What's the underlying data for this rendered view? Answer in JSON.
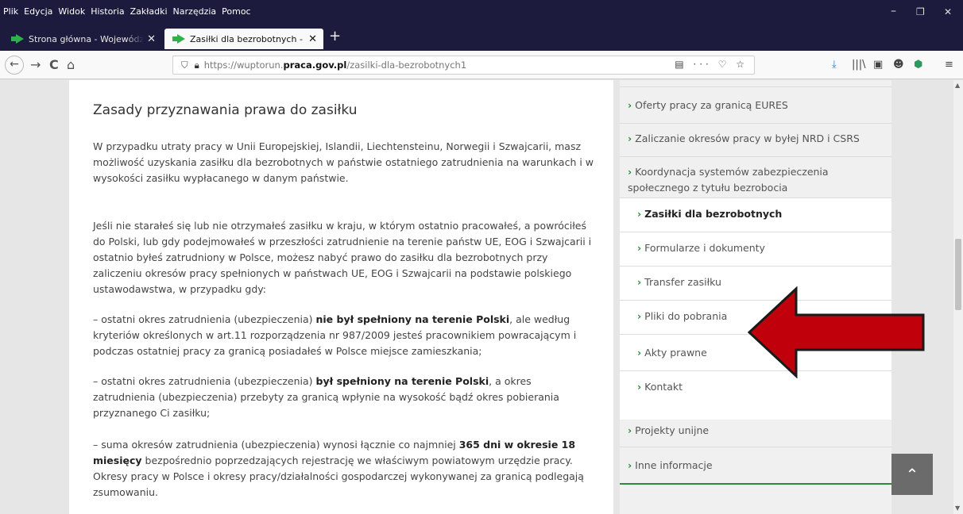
{
  "menu": [
    "Plik",
    "Edycja",
    "Widok",
    "Historia",
    "Zakładki",
    "Narzędzia",
    "Pomoc"
  ],
  "window_controls": {
    "minimize": "–",
    "restore": "❐",
    "close": "✕"
  },
  "tabs": [
    {
      "title": "Strona główna - Wojewódzki Urząd Pracy",
      "close": "✕"
    },
    {
      "title": "Zasiłki dla bezrobotnych - Wojewódzki",
      "close": "✕"
    }
  ],
  "new_tab": "+",
  "nav": {
    "back": "←",
    "forward": "→",
    "reload": "C",
    "home": "⌂"
  },
  "url": {
    "prefix": "https://wuptorun.",
    "domain": "praca.gov.pl",
    "path": "/zasilki-dla-bezrobotnych1"
  },
  "url_tools": "▤ ··· ♡ ☆",
  "right_tools": [
    "⤓",
    "|||\\",
    "▣",
    "☻",
    "⬢",
    "≡"
  ],
  "article": {
    "title": "Zasady przyznawania prawa do zasiłku",
    "p1": "W przypadku utraty pracy w Unii Europejskiej, Islandii, Liechtensteinu, Norwegii i Szwajcarii, masz możliwość uzyskania zasiłku dla bezrobotnych w państwie ostatniego zatrudnienia na warunkach i w wysokości zasiłku wypłacanego w danym państwie.",
    "p2": "Jeśli nie starałeś się lub nie otrzymałeś zasiłku w kraju, w którym ostatnio pracowałeś, a powróciłeś do Polski, lub gdy podejmowałeś w przeszłości zatrudnienie na terenie państw UE, EOG i Szwajcarii i ostatnio byłeś zatrudniony w Polsce, możesz nabyć prawo do zasiłku dla bezrobotnych przy zaliczeniu okresów pracy spełnionych w państwach UE, EOG i Szwajcarii na podstawie polskiego ustawodawstwa, w przypadku gdy:",
    "p3_a": "– ostatni okres zatrudnienia (ubezpieczenia) ",
    "p3_b": "nie był spełniony na terenie Polski",
    "p3_c": ", ale według kryteriów określonych w art.11 rozporządzenia nr 987/2009 jesteś pracownikiem powracającym i podczas ostatniej pracy za granicą posiadałeś w Polsce miejsce zamieszkania;",
    "p4_a": "– ostatni okres zatrudnienia (ubezpieczenia) ",
    "p4_b": "był spełniony na terenie Polski",
    "p4_c": ", a okres zatrudnienia (ubezpieczenia) przebyty za granicą wpłynie na wysokość bądź okres pobierania przyznanego Ci zasiłku;",
    "p5_a": "– suma okresów zatrudnienia (ubezpieczenia) wynosi łącznie co najmniej ",
    "p5_b": "365 dni w okresie 18 miesięcy",
    "p5_c": " bezpośrednio poprzedzających rejestrację we właściwym powiatowym urzędzie pracy. Okresy pracy w Polsce i okresy pracy/działalności gospodarczej wykonywanej za granicą podlegają zsumowaniu."
  },
  "sidebar": {
    "items": [
      "Oferty pracy za granicą EURES",
      "Zaliczanie okresów pracy w byłej NRD i CSRS",
      "Koordynacja systemów zabezpieczenia społecznego z tytułu bezrobocia"
    ],
    "subitems": [
      "Zasiłki dla bezrobotnych",
      "Formularze i dokumenty",
      "Transfer zasiłku",
      "Pliki do pobrania",
      "Akty prawne",
      "Kontakt"
    ],
    "bottom_items": [
      "Projekty unijne",
      "Inne informacje"
    ],
    "chevron": "›"
  },
  "back_to_top": "⌃",
  "arrow_color": "#c0000b"
}
